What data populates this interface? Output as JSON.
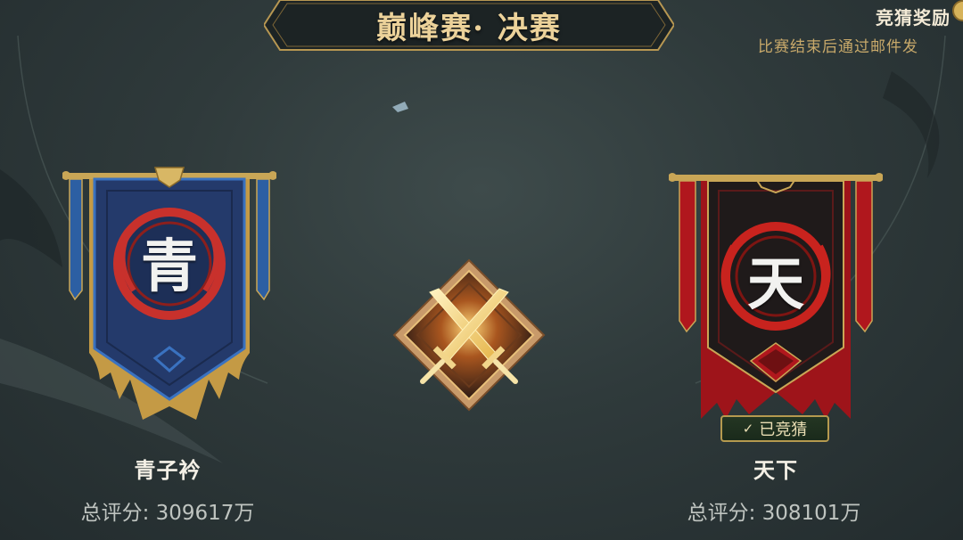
{
  "header": {
    "title": "巅峰赛· 决赛"
  },
  "reward": {
    "title": "竞猜奖励",
    "note": "比赛结束后通过邮件发"
  },
  "teams": [
    {
      "name": "青子衿",
      "emblem": "青",
      "score": "总评分: 309617万",
      "color": "#2b4a86",
      "side": "left"
    },
    {
      "name": "天下",
      "emblem": "天",
      "score": "总评分: 308101万",
      "color": "#a8161b",
      "side": "right",
      "status": "已竞猜"
    }
  ],
  "icons": {
    "vs": "crossed-swords-icon",
    "check": "check-icon"
  },
  "colors": {
    "gold": "#d4ad5c",
    "blue": "#2b4a86",
    "red": "#a8161b",
    "background": "#2f3a3b"
  }
}
